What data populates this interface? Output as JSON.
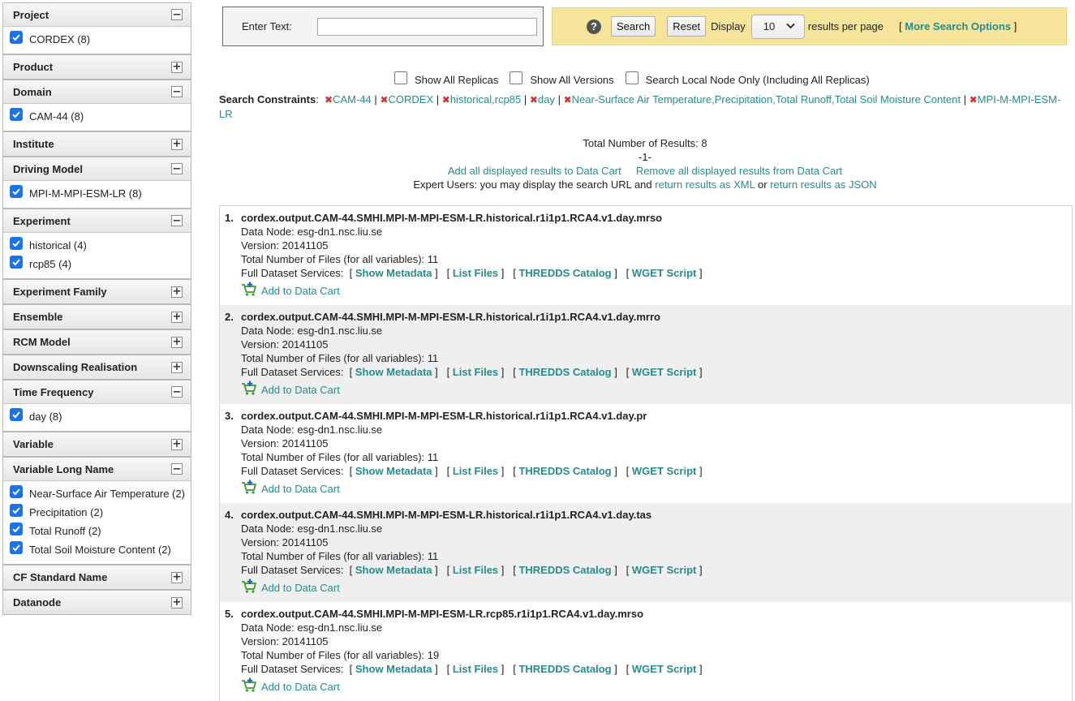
{
  "sidebar": {
    "facets": [
      {
        "label": "Project",
        "expanded": true,
        "items": [
          "CORDEX (8)"
        ]
      },
      {
        "label": "Product",
        "expanded": false,
        "items": []
      },
      {
        "label": "Domain",
        "expanded": true,
        "items": [
          "CAM-44 (8)"
        ]
      },
      {
        "label": "Institute",
        "expanded": false,
        "items": []
      },
      {
        "label": "Driving Model",
        "expanded": true,
        "items": [
          "MPI-M-MPI-ESM-LR (8)"
        ]
      },
      {
        "label": "Experiment",
        "expanded": true,
        "items": [
          "historical (4)",
          "rcp85 (4)"
        ]
      },
      {
        "label": "Experiment Family",
        "expanded": false,
        "items": []
      },
      {
        "label": "Ensemble",
        "expanded": false,
        "items": []
      },
      {
        "label": "RCM Model",
        "expanded": false,
        "items": []
      },
      {
        "label": "Downscaling Realisation",
        "expanded": false,
        "items": []
      },
      {
        "label": "Time Frequency",
        "expanded": true,
        "items": [
          "day (8)"
        ]
      },
      {
        "label": "Variable",
        "expanded": false,
        "items": []
      },
      {
        "label": "Variable Long Name",
        "expanded": true,
        "items": [
          "Near-Surface Air Temperature (2)",
          "Precipitation (2)",
          "Total Runoff (2)",
          "Total Soil Moisture Content (2)"
        ]
      },
      {
        "label": "CF Standard Name",
        "expanded": false,
        "items": []
      },
      {
        "label": "Datanode",
        "expanded": false,
        "items": []
      }
    ],
    "expand_symbol": "+",
    "collapse_symbol": "−"
  },
  "search": {
    "text_label": "Enter Text:",
    "text_value": "",
    "help_symbol": "?",
    "search_button": "Search",
    "reset_button": "Reset",
    "display_label": "Display",
    "per_page_value": "10",
    "per_page_suffix": "results per page",
    "more_options": "More Search Options"
  },
  "options": {
    "show_all_replicas": "Show All Replicas",
    "show_all_versions": "Show All Versions",
    "search_local_node": "Search Local Node Only (Including All Replicas)"
  },
  "constraints": {
    "label": "Search Constraints",
    "items": [
      "CAM-44",
      "CORDEX",
      "historical,rcp85",
      "day",
      "Near-Surface Air Temperature,Precipitation,Total Runoff,Total Soil Moisture Content",
      "MPI-M-MPI-ESM-LR"
    ]
  },
  "summary": {
    "total": "Total Number of Results: 8",
    "page": "-1-",
    "add_all": "Add all displayed results to Data Cart",
    "remove_all": "Remove all displayed results from Data Cart",
    "expert_prefix": "Expert Users: you may display the search URL and",
    "xml_link": "return results as XML",
    "or_text": "or",
    "json_link": "return results as JSON"
  },
  "results": [
    {
      "num": "1.",
      "title": "cordex.output.CAM-44.SMHI.MPI-M-MPI-ESM-LR.historical.r1i1p1.RCA4.v1.day.mrso",
      "data_node": "Data Node: esg-dn1.nsc.liu.se",
      "version": "Version: 20141105",
      "files": "Total Number of Files (for all variables): 11"
    },
    {
      "num": "2.",
      "title": "cordex.output.CAM-44.SMHI.MPI-M-MPI-ESM-LR.historical.r1i1p1.RCA4.v1.day.mrro",
      "data_node": "Data Node: esg-dn1.nsc.liu.se",
      "version": "Version: 20141105",
      "files": "Total Number of Files (for all variables): 11"
    },
    {
      "num": "3.",
      "title": "cordex.output.CAM-44.SMHI.MPI-M-MPI-ESM-LR.historical.r1i1p1.RCA4.v1.day.pr",
      "data_node": "Data Node: esg-dn1.nsc.liu.se",
      "version": "Version: 20141105",
      "files": "Total Number of Files (for all variables): 11"
    },
    {
      "num": "4.",
      "title": "cordex.output.CAM-44.SMHI.MPI-M-MPI-ESM-LR.historical.r1i1p1.RCA4.v1.day.tas",
      "data_node": "Data Node: esg-dn1.nsc.liu.se",
      "version": "Version: 20141105",
      "files": "Total Number of Files (for all variables): 11"
    },
    {
      "num": "5.",
      "title": "cordex.output.CAM-44.SMHI.MPI-M-MPI-ESM-LR.rcp85.r1i1p1.RCA4.v1.day.mrso",
      "data_node": "Data Node: esg-dn1.nsc.liu.se",
      "version": "Version: 20141105",
      "files": "Total Number of Files (for all variables): 19"
    }
  ],
  "result_labels": {
    "services": "Full Dataset Services:",
    "show_metadata": "Show Metadata",
    "list_files": "List Files",
    "thredds": "THREDDS Catalog",
    "wget": "WGET Script",
    "add_to_cart": "Add to Data Cart"
  },
  "icons": {
    "checkbox": "checked-checkbox-icon",
    "remove": "remove-x-icon",
    "cart": "add-to-cart-icon",
    "help": "help-icon"
  },
  "colors": {
    "link": "#2b8a8a",
    "checkbox": "#1a73e8",
    "remove_x": "#d0312d",
    "options_panel": "#f6e49a",
    "alt_row": "#efefef"
  }
}
